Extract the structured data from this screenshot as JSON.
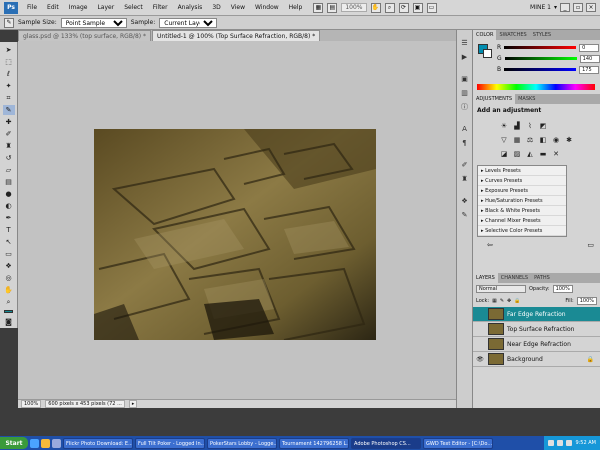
{
  "app": {
    "logo": "Ps",
    "workspace": "MINE 1"
  },
  "menu": [
    "File",
    "Edit",
    "Image",
    "Layer",
    "Select",
    "Filter",
    "Analysis",
    "3D",
    "View",
    "Window",
    "Help"
  ],
  "menubar": {
    "zoom": "100%"
  },
  "options": {
    "sample_size_label": "Sample Size:",
    "sample_size_value": "Point Sample",
    "sample_label": "Sample:",
    "sample_value": "Current Layer"
  },
  "doc_tabs": [
    {
      "label": "glass.psd @ 133% (top surface, RGB/8) *"
    },
    {
      "label": "Untitled-1 @ 100% (Top Surface Refraction, RGB/8) *"
    }
  ],
  "status": {
    "zoom": "100%",
    "doc_info": "600 pixels x 453 pixels (72 ..."
  },
  "color_panel": {
    "tabs": [
      "COLOR",
      "SWATCHES",
      "STYLES"
    ],
    "channels": [
      {
        "label": "R",
        "value": "0",
        "track": "#e0e0e0"
      },
      {
        "label": "G",
        "value": "140",
        "track": "#3faa6a"
      },
      {
        "label": "B",
        "value": "175",
        "track": "#3d64d8"
      }
    ],
    "foreground_hex": "#008caf"
  },
  "adjustments_panel": {
    "tabs": [
      "ADJUSTMENTS",
      "MASKS"
    ],
    "title": "Add an adjustment",
    "presets": [
      "Levels Presets",
      "Curves Presets",
      "Exposure Presets",
      "Hue/Saturation Presets",
      "Black & White Presets",
      "Channel Mixer Presets",
      "Selective Color Presets"
    ]
  },
  "layers_panel": {
    "tabs": [
      "LAYERS",
      "CHANNELS",
      "PATHS"
    ],
    "blend_mode": "Normal",
    "opacity_label": "Opacity:",
    "opacity": "100%",
    "lock_label": "Lock:",
    "fill_label": "Fill:",
    "fill": "100%",
    "layers": [
      {
        "name": "Far Edge Refraction",
        "selected": true,
        "visible": false
      },
      {
        "name": "Top Surface Refraction",
        "selected": false,
        "visible": false
      },
      {
        "name": "Near Edge Refraction",
        "selected": false,
        "visible": false
      },
      {
        "name": "Background",
        "selected": false,
        "visible": true
      }
    ]
  },
  "taskbar": {
    "start": "Start",
    "tasks": [
      {
        "label": "Flickr Photo Download: E..."
      },
      {
        "label": "Full Tilt Poker - Logged In..."
      },
      {
        "label": "PokerStars Lobby - Logge..."
      },
      {
        "label": "Tournament 142796258 L..."
      },
      {
        "label": "Adobe Photoshop CS..."
      },
      {
        "label": "GWD Text Editor - [C:\\Do..."
      }
    ],
    "clock": "9:52 AM"
  }
}
